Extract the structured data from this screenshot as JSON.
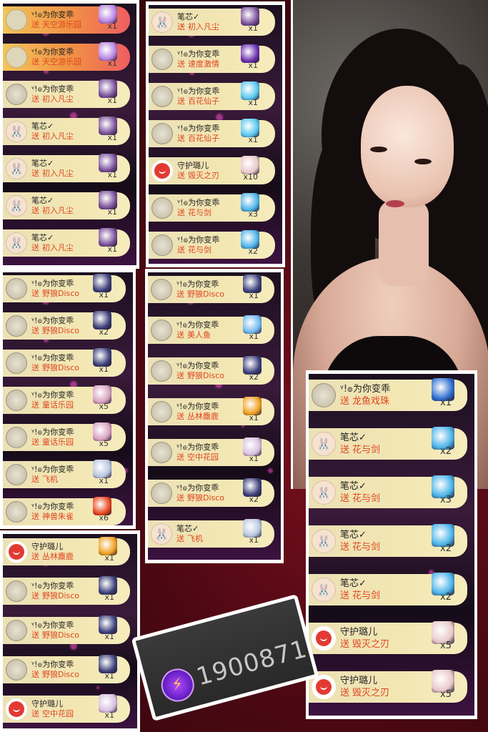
{
  "panels": [
    {
      "id": "p1",
      "rows": [
        {
          "avatar": "seal",
          "vip": true,
          "crown": true,
          "user": "ᵞ!๏为你变乖",
          "gift": "天空游乐园",
          "qty": "x1",
          "gift_color": "#b884e0"
        },
        {
          "avatar": "seal",
          "vip": true,
          "crown": true,
          "user": "ᵞ!๏为你变乖",
          "gift": "天空游乐园",
          "qty": "x1",
          "gift_color": "#b884e0"
        },
        {
          "avatar": "seal",
          "user": "ᵞ!๏为你变乖",
          "gift": "初入凡尘",
          "qty": "x1",
          "gift_color": "#7a4f9a"
        },
        {
          "avatar": "bunny",
          "user": "笔芯✓",
          "gift": "初入凡尘",
          "qty": "x1",
          "gift_color": "#7a4f9a"
        },
        {
          "avatar": "bunny",
          "user": "笔芯✓",
          "gift": "初入凡尘",
          "qty": "x1",
          "gift_color": "#7a4f9a"
        },
        {
          "avatar": "bunny",
          "user": "笔芯✓",
          "gift": "初入凡尘",
          "qty": "x1",
          "gift_color": "#7a4f9a"
        },
        {
          "avatar": "bunny",
          "user": "笔芯✓",
          "gift": "初入凡尘",
          "qty": "x1",
          "gift_color": "#7a4f9a"
        }
      ]
    },
    {
      "id": "p2",
      "rows": [
        {
          "avatar": "bunny",
          "user": "笔芯✓",
          "gift": "初入凡尘",
          "qty": "x1",
          "gift_color": "#7a4f9a"
        },
        {
          "avatar": "seal",
          "user": "ᵞ!๏为你变乖",
          "gift": "速度激情",
          "qty": "x1",
          "gift_color": "#6a2fb0"
        },
        {
          "avatar": "seal",
          "user": "ᵞ!๏为你变乖",
          "gift": "百花仙子",
          "qty": "x1",
          "gift_color": "#57c7f0"
        },
        {
          "avatar": "seal",
          "user": "ᵞ!๏为你变乖",
          "gift": "百花仙子",
          "qty": "x1",
          "gift_color": "#57c7f0"
        },
        {
          "avatar": "red",
          "user": "守护璐儿",
          "gift": "毁灭之刃",
          "qty": "x10",
          "gift_color": "#e9c9c9"
        },
        {
          "avatar": "seal",
          "user": "ᵞ!๏为你变乖",
          "gift": "花与剑",
          "qty": "x3",
          "gift_color": "#4bb3e8"
        },
        {
          "avatar": "seal",
          "user": "ᵞ!๏为你变乖",
          "gift": "花与剑",
          "qty": "x2",
          "gift_color": "#4bb3e8"
        }
      ]
    },
    {
      "id": "p3",
      "rows": [
        {
          "avatar": "seal",
          "user": "ᵞ!๏为你变乖",
          "gift": "野狼Disco",
          "qty": "x1",
          "gift_color": "#3b3f7a"
        },
        {
          "avatar": "seal",
          "user": "ᵞ!๏为你变乖",
          "gift": "野狼Disco",
          "qty": "x2",
          "gift_color": "#3b3f7a"
        },
        {
          "avatar": "seal",
          "user": "ᵞ!๏为你变乖",
          "gift": "野狼Disco",
          "qty": "x1",
          "gift_color": "#3b3f7a"
        },
        {
          "avatar": "seal",
          "user": "ᵞ!๏为你变乖",
          "gift": "童话乐园",
          "qty": "x5",
          "gift_color": "#d8a0c0"
        },
        {
          "avatar": "seal",
          "user": "ᵞ!๏为你变乖",
          "gift": "童话乐园",
          "qty": "x5",
          "gift_color": "#d8a0c0"
        },
        {
          "avatar": "seal",
          "user": "ᵞ!๏为你变乖",
          "gift": "飞机",
          "qty": "x1",
          "gift_color": "#b8c6e0"
        },
        {
          "avatar": "seal",
          "user": "ᵞ!๏为你变乖",
          "gift": "神兽朱雀",
          "qty": "x6",
          "gift_color": "#e8451c"
        }
      ]
    },
    {
      "id": "p4",
      "rows": [
        {
          "avatar": "seal",
          "user": "ᵞ!๏为你变乖",
          "gift": "野狼Disco",
          "qty": "x1",
          "gift_color": "#3b3f7a"
        },
        {
          "avatar": "seal",
          "user": "ᵞ!๏为你变乖",
          "gift": "美人鱼",
          "qty": "x1",
          "gift_color": "#6fb8f0"
        },
        {
          "avatar": "seal",
          "user": "ᵞ!๏为你变乖",
          "gift": "野狼Disco",
          "qty": "x2",
          "gift_color": "#3b3f7a"
        },
        {
          "avatar": "seal",
          "user": "ᵞ!๏为你变乖",
          "gift": "丛林麋鹿",
          "qty": "x1",
          "gift_color": "#f0a020"
        },
        {
          "avatar": "seal",
          "user": "ᵞ!๏为你变乖",
          "gift": "空中花园",
          "qty": "x1",
          "gift_color": "#d8c0e0"
        },
        {
          "avatar": "seal",
          "user": "ᵞ!๏为你变乖",
          "gift": "野狼Disco",
          "qty": "x2",
          "gift_color": "#3b3f7a"
        },
        {
          "avatar": "bunny",
          "user": "笔芯✓",
          "gift": "飞机",
          "qty": "x1",
          "gift_color": "#b8c6e0"
        }
      ]
    },
    {
      "id": "p5",
      "rows": [
        {
          "avatar": "red",
          "user": "守护璐儿",
          "gift": "丛林麋鹿",
          "qty": "x1",
          "gift_color": "#f0a020"
        },
        {
          "avatar": "seal",
          "user": "ᵞ!๏为你变乖",
          "gift": "野狼Disco",
          "qty": "x1",
          "gift_color": "#3b3f7a"
        },
        {
          "avatar": "seal",
          "user": "ᵞ!๏为你变乖",
          "gift": "野狼Disco",
          "qty": "x1",
          "gift_color": "#3b3f7a"
        },
        {
          "avatar": "seal",
          "user": "ᵞ!๏为你变乖",
          "gift": "野狼Disco",
          "qty": "x1",
          "gift_color": "#3b3f7a"
        },
        {
          "avatar": "red",
          "user": "守护璐儿",
          "gift": "空中花园",
          "qty": "x1",
          "gift_color": "#d8c0e0"
        }
      ]
    },
    {
      "id": "p6",
      "rows": [
        {
          "avatar": "seal",
          "user": "ᵞ!๏为你变乖",
          "gift": "龙鱼戏珠",
          "qty": "x1",
          "gift_color": "#2f6fd0"
        },
        {
          "avatar": "bunny",
          "user": "笔芯✓",
          "gift": "花与剑",
          "qty": "x2",
          "gift_color": "#4bb3e8"
        },
        {
          "avatar": "bunny",
          "user": "笔芯✓",
          "gift": "花与剑",
          "qty": "x3",
          "gift_color": "#4bb3e8"
        },
        {
          "avatar": "bunny",
          "user": "笔芯✓",
          "gift": "花与剑",
          "qty": "x2",
          "gift_color": "#4bb3e8"
        },
        {
          "avatar": "bunny",
          "user": "笔芯✓",
          "gift": "花与剑",
          "qty": "x2",
          "gift_color": "#4bb3e8"
        },
        {
          "avatar": "red",
          "user": "守护璐儿",
          "gift": "毁灭之刃",
          "qty": "x5",
          "gift_color": "#e9c9c9"
        },
        {
          "avatar": "red",
          "user": "守护璐儿",
          "gift": "毁灭之刃",
          "qty": "x5",
          "gift_color": "#e9c9c9"
        }
      ]
    }
  ],
  "labels": {
    "give": "送"
  },
  "coin": {
    "value": "1900871",
    "icon": "lightning-coin-icon"
  },
  "colors": {
    "username": "#222222",
    "gift_text": "#e0451c",
    "row_bg": "#f2e6b3",
    "coin_text": "#c7c7c7"
  }
}
